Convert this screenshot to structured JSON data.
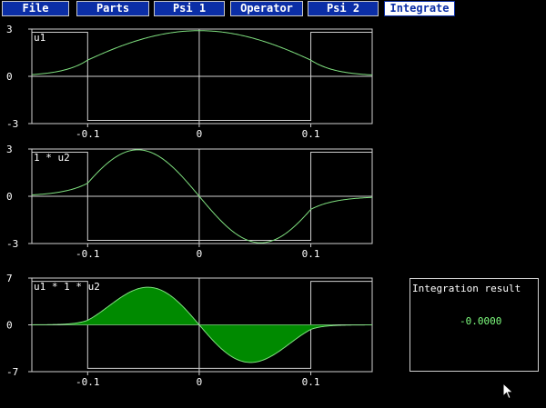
{
  "menu": {
    "tabs": [
      {
        "label": "File"
      },
      {
        "label": "Parts"
      },
      {
        "label": "Psi 1"
      },
      {
        "label": "Operator"
      },
      {
        "label": "Psi 2"
      },
      {
        "label": "Integrate"
      }
    ],
    "active": "Integrate"
  },
  "colors": {
    "curve": "#7fe07f",
    "fill": "#008a00",
    "frame": "#cfcfcf",
    "tab": "#0b2ea6"
  },
  "plots": [
    {
      "label": "u1",
      "y_tick_labels": [
        "3",
        "0",
        "-3"
      ],
      "x_tick_labels": [
        "-0.1",
        "0",
        "0.1"
      ],
      "xlim": [
        -0.15,
        0.155
      ],
      "ylim": [
        -3,
        3
      ],
      "potential_height": 2.8,
      "well_edges": [
        -0.1,
        0.1
      ],
      "curve": "cosine ground state",
      "filled": false
    },
    {
      "label": "1  * u2",
      "y_tick_labels": [
        "3",
        "0",
        "-3"
      ],
      "x_tick_labels": [
        "-0.1",
        "0",
        "0.1"
      ],
      "xlim": [
        -0.15,
        0.155
      ],
      "ylim": [
        -3,
        3
      ],
      "potential_height": 2.8,
      "well_edges": [
        -0.1,
        0.1
      ],
      "curve": "sine first excited state",
      "filled": false
    },
    {
      "label": "u1 * 1 * u2",
      "y_tick_labels": [
        "7",
        "0",
        "-7"
      ],
      "x_tick_labels": [
        "-0.1",
        "0",
        "0.1"
      ],
      "xlim": [
        -0.15,
        0.155
      ],
      "ylim": [
        -7,
        7
      ],
      "potential_height": 6.5,
      "well_edges": [
        -0.1,
        0.1
      ],
      "curve": "product u1*u2",
      "filled": true
    }
  ],
  "result": {
    "title": "Integration result",
    "value": "-0.0000"
  }
}
